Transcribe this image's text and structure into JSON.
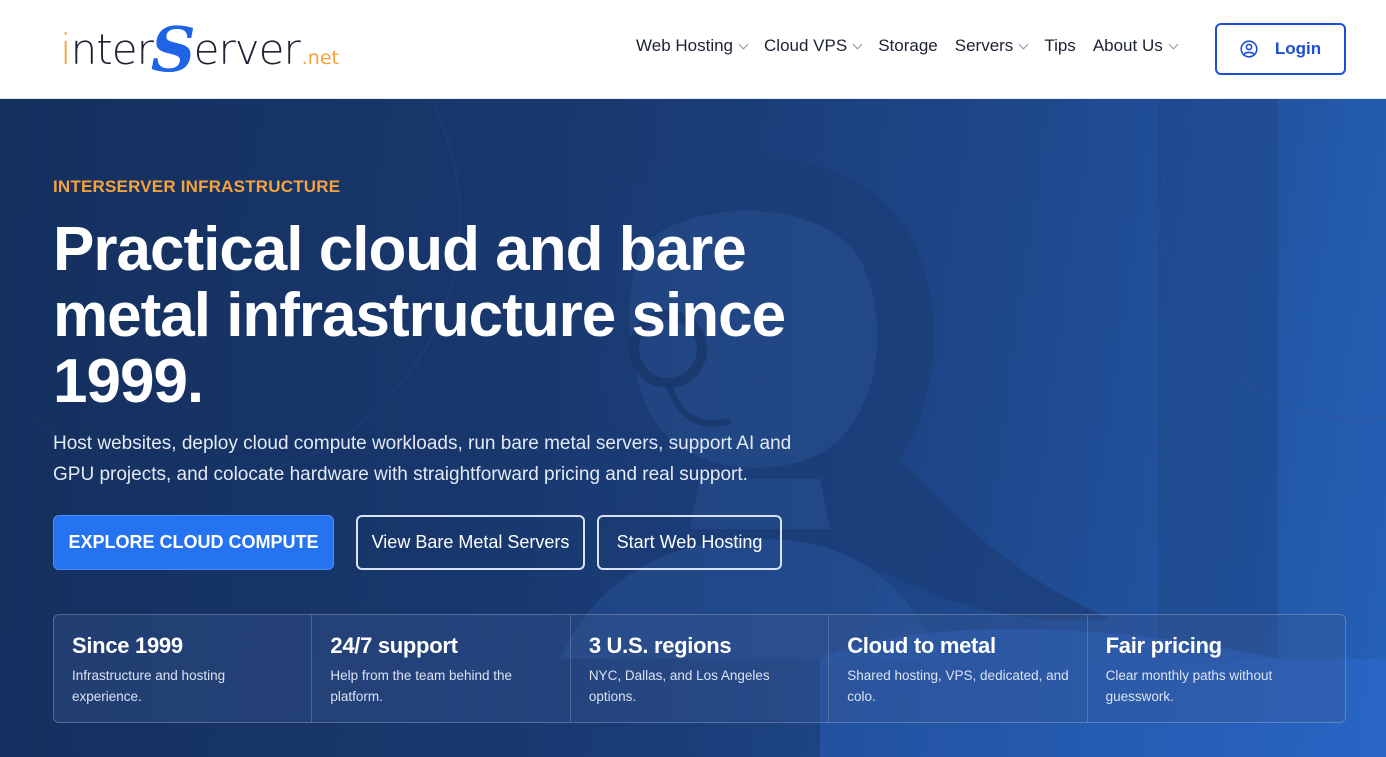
{
  "header": {
    "logo": {
      "part1": "inter",
      "s": "S",
      "part2": "erver",
      "suffix": ".net"
    },
    "nav": [
      {
        "label": "Web Hosting",
        "has_dropdown": true
      },
      {
        "label": "Cloud VPS",
        "has_dropdown": true
      },
      {
        "label": "Storage",
        "has_dropdown": false
      },
      {
        "label": "Servers",
        "has_dropdown": true
      },
      {
        "label": "Tips",
        "has_dropdown": false
      },
      {
        "label": "About Us",
        "has_dropdown": true
      }
    ],
    "login_label": "Login",
    "login_icon": "user-circle-icon"
  },
  "hero": {
    "eyebrow": "INTERSERVER INFRASTRUCTURE",
    "headline": "Practical cloud and bare metal infrastructure since 1999.",
    "subcopy": "Host websites, deploy cloud compute workloads, run bare metal servers, support AI and GPU projects, and colocate hardware with straightforward pricing and real support.",
    "buttons": {
      "primary": "EXPLORE CLOUD COMPUTE",
      "bare_metal": "View Bare Metal Servers",
      "web_hosting": "Start Web Hosting"
    },
    "stats": [
      {
        "title": "Since 1999",
        "text": "Infrastructure and hosting experience."
      },
      {
        "title": "24/7 support",
        "text": "Help from the team behind the platform."
      },
      {
        "title": "3 U.S. regions",
        "text": "NYC, Dallas, and Los Angeles options."
      },
      {
        "title": "Cloud to metal",
        "text": "Shared hosting, VPS, dedicated, and colo."
      },
      {
        "title": "Fair pricing",
        "text": "Clear monthly paths without guesswork."
      }
    ]
  },
  "colors": {
    "brand_blue": "#1c4fd8",
    "accent_orange": "#f7a23b",
    "primary_button": "#2673f2",
    "hero_bg": "#1a3a73"
  }
}
